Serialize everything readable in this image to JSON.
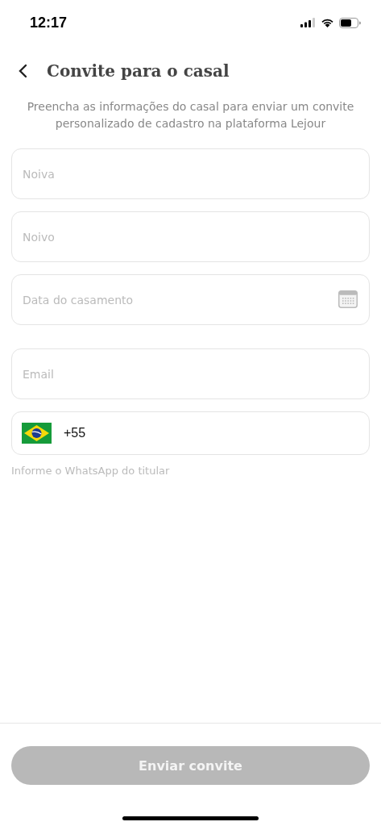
{
  "status_bar": {
    "time": "12:17"
  },
  "header": {
    "title": "Convite para o casal",
    "subtitle": "Preencha as informações do casal para enviar um convite personalizado de cadastro na plataforma Lejour"
  },
  "fields": [
    {
      "kind": "text",
      "placeholder": "Noiva"
    },
    {
      "kind": "text",
      "placeholder": "Noivo"
    },
    {
      "kind": "date",
      "placeholder": "Data do casamento"
    },
    {
      "kind": "text",
      "placeholder": "Email"
    },
    {
      "kind": "phone",
      "value": "+55",
      "helper": "Informe o WhatsApp do titular"
    }
  ],
  "submit": {
    "label": "Enviar convite",
    "disabled": true
  }
}
